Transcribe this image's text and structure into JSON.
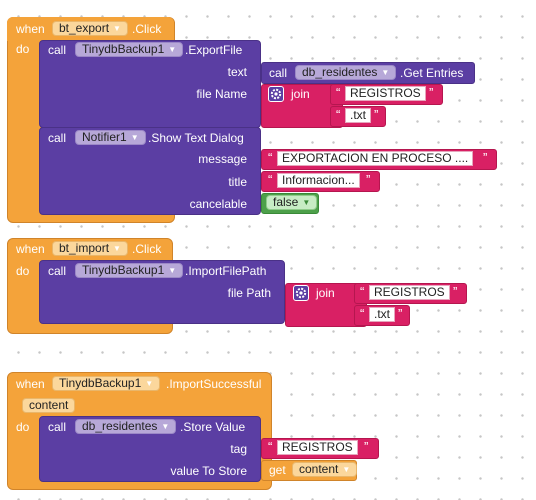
{
  "blocks": {
    "export_event": {
      "when_label": "when",
      "component": "bt_export",
      "event": ".Click",
      "do_label": "do",
      "export_call": {
        "call_label": "call",
        "component": "TinydbBackup1",
        "method": ".ExportFile",
        "params": {
          "text": "text",
          "file_name": "file Name"
        },
        "text_value": {
          "call_label": "call",
          "component": "db_residentes",
          "method": ".Get Entries"
        },
        "join": {
          "label": "join",
          "str1": "REGISTROS",
          "str2": ".txt"
        }
      },
      "notifier_call": {
        "call_label": "call",
        "component": "Notifier1",
        "method": ".Show Text Dialog",
        "params": {
          "message": "message",
          "title": "title",
          "cancelable": "cancelable"
        },
        "message_value": "EXPORTACION EN PROCESO ....",
        "title_value": "Informacion...",
        "cancelable_value": "false"
      }
    },
    "import_event": {
      "when_label": "when",
      "component": "bt_import",
      "event": ".Click",
      "do_label": "do",
      "import_call": {
        "call_label": "call",
        "component": "TinydbBackup1",
        "method": ".ImportFilePath",
        "params": {
          "file_path": "file Path"
        },
        "join": {
          "label": "join",
          "str1": "REGISTROS",
          "str2": ".txt"
        }
      }
    },
    "import_success_event": {
      "when_label": "when",
      "component": "TinydbBackup1",
      "event": ".ImportSuccessful",
      "param": "content",
      "do_label": "do",
      "store_call": {
        "call_label": "call",
        "component": "db_residentes",
        "method": ".Store Value",
        "params": {
          "tag": "tag",
          "value_to_store": "value To Store"
        },
        "tag_value": "REGISTROS",
        "get_label": "get",
        "get_var": "content"
      }
    }
  },
  "icons": {
    "dropdown": "dropdown-arrow-icon",
    "mutator": "gear-icon",
    "quote": "quote-mark-icon"
  },
  "colors": {
    "event_block": "#f4a33a",
    "call_block": "#5b3ea3",
    "text_block": "#d92064",
    "logic_block": "#4da04a",
    "workspace": "#ffffff"
  }
}
